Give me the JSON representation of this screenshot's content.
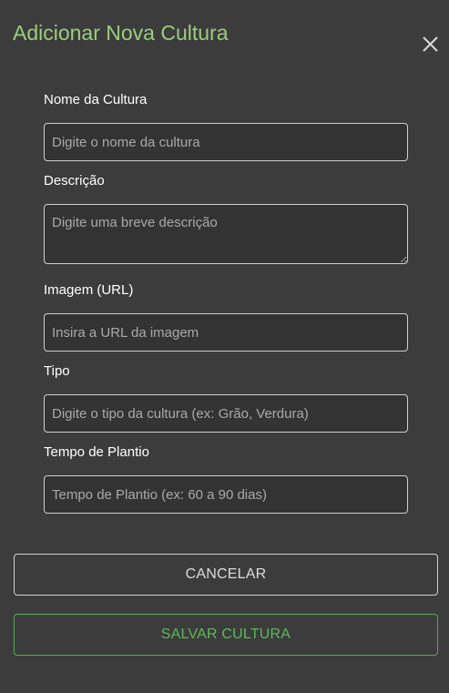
{
  "dialog": {
    "title": "Adicionar Nova Cultura",
    "close_icon": "close-icon"
  },
  "form": {
    "nome": {
      "label": "Nome da Cultura",
      "placeholder": "Digite o nome da cultura",
      "value": ""
    },
    "descricao": {
      "label": "Descrição",
      "placeholder": "Digite uma breve descrição",
      "value": ""
    },
    "imagem": {
      "label": "Imagem (URL)",
      "placeholder": "Insira a URL da imagem",
      "value": ""
    },
    "tipo": {
      "label": "Tipo",
      "placeholder": "Digite o tipo da cultura (ex: Grão, Verdura)",
      "value": ""
    },
    "tempo": {
      "label": "Tempo de Plantio",
      "placeholder": "Tempo de Plantio (ex: 60 a 90 dias)",
      "value": ""
    }
  },
  "actions": {
    "cancel_label": "CANCELAR",
    "save_label": "SALVAR CULTURA"
  },
  "colors": {
    "background": "#3c3c3c",
    "title": "#9ccc7e",
    "save_accent": "#5cb85c",
    "field_border": "#cfcfcf"
  }
}
